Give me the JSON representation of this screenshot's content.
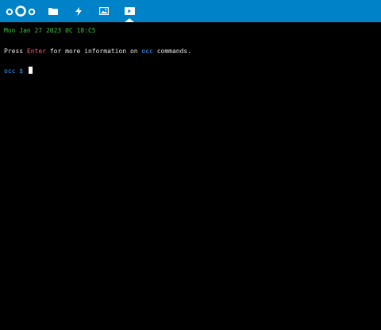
{
  "header": {
    "background_color": "#0082c9",
    "logo_icon": "nextcloud-logo-icon",
    "apps": [
      {
        "icon": "files-folder-icon"
      },
      {
        "icon": "activity-bolt-icon"
      },
      {
        "icon": "photos-image-icon"
      },
      {
        "icon": "terminal-icon",
        "active": true
      }
    ]
  },
  "terminal": {
    "date_line": "Mon Jan 27 2023 0C 18:C5",
    "help_line": {
      "part1": "Press ",
      "enter_key": "Enter",
      "part2": " for more information on ",
      "occ_command": "occ",
      "part3": " commands."
    },
    "prompt": {
      "command": "occ",
      "symbol": " $ "
    },
    "colors": {
      "background": "#000000",
      "date_text": "#3ec33e",
      "default_text": "#e6e6e6",
      "highlight_red": "#ff5a6e",
      "highlight_blue": "#3aa0ff"
    }
  }
}
